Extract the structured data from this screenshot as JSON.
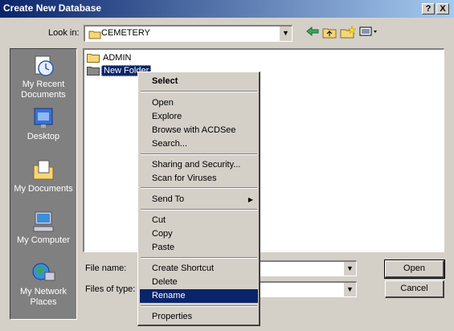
{
  "window": {
    "title": "Create New Database",
    "help_btn": "?",
    "close_btn": "X"
  },
  "lookin": {
    "label": "Look in:",
    "value": "CEMETERY"
  },
  "toolbar": {
    "back_icon": "back-arrow-icon",
    "up_icon": "up-folder-icon",
    "newfolder_icon": "new-folder-icon",
    "views_icon": "views-menu-icon"
  },
  "places": [
    {
      "label": "My Recent Documents",
      "line1": "My Recent",
      "line2": "Documents",
      "icon": "recent-documents-icon"
    },
    {
      "label": "Desktop",
      "line1": "Desktop",
      "line2": "",
      "icon": "desktop-icon"
    },
    {
      "label": "My Documents",
      "line1": "My Documents",
      "line2": "",
      "icon": "my-documents-icon"
    },
    {
      "label": "My Computer",
      "line1": "My Computer",
      "line2": "",
      "icon": "my-computer-icon"
    },
    {
      "label": "My Network Places",
      "line1": "My Network",
      "line2": "Places",
      "icon": "network-places-icon"
    }
  ],
  "files": [
    {
      "name": "ADMIN"
    },
    {
      "name": "New Folder"
    }
  ],
  "bottom": {
    "filename_label": "File name:",
    "filename_value": "",
    "filetype_label": "Files of type:",
    "filetype_value": "",
    "open_label": "Open",
    "cancel_label": "Cancel"
  },
  "context_menu": {
    "items": [
      {
        "label": "Select"
      },
      {
        "label": "Open"
      },
      {
        "label": "Explore"
      },
      {
        "label": "Browse with ACDSee"
      },
      {
        "label": "Search..."
      },
      {
        "label": "Sharing and Security..."
      },
      {
        "label": "Scan for Viruses"
      },
      {
        "label": "Send To"
      },
      {
        "label": "Cut"
      },
      {
        "label": "Copy"
      },
      {
        "label": "Paste"
      },
      {
        "label": "Create Shortcut"
      },
      {
        "label": "Delete"
      },
      {
        "label": "Rename"
      },
      {
        "label": "Properties"
      }
    ],
    "highlighted": "Rename"
  },
  "colors": {
    "title_start": "#0a246a",
    "title_end": "#a6caf0",
    "face": "#d4d0c8",
    "highlight": "#0a246a"
  }
}
